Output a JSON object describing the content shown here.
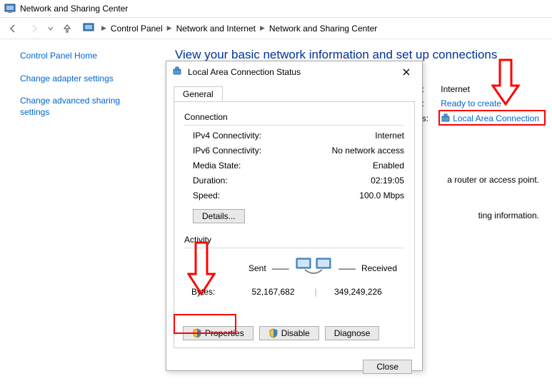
{
  "window": {
    "title": "Network and Sharing Center"
  },
  "breadcrumb": {
    "items": [
      "Control Panel",
      "Network and Internet",
      "Network and Sharing Center"
    ]
  },
  "sidebar": {
    "items": [
      {
        "label": "Control Panel Home"
      },
      {
        "label": "Change adapter settings"
      },
      {
        "label": "Change advanced sharing settings"
      }
    ]
  },
  "main": {
    "heading": "View your basic network information and set up connections",
    "access_type_label": "pe:",
    "access_type_value": "Internet",
    "homegroup_label": "up:",
    "homegroup_value": "Ready to create",
    "connections_label": "ons:",
    "connection_link": "Local Area Connection",
    "snippet_line1": "a router or access point.",
    "snippet_line2": "ting information."
  },
  "dialog": {
    "title": "Local Area Connection Status",
    "tab": "General",
    "connection_group": "Connection",
    "ipv4_label": "IPv4 Connectivity:",
    "ipv4_value": "Internet",
    "ipv6_label": "IPv6 Connectivity:",
    "ipv6_value": "No network access",
    "media_label": "Media State:",
    "media_value": "Enabled",
    "duration_label": "Duration:",
    "duration_value": "02:19:05",
    "speed_label": "Speed:",
    "speed_value": "100.0 Mbps",
    "details_btn": "Details...",
    "activity_group": "Activity",
    "sent_label": "Sent",
    "received_label": "Received",
    "bytes_label": "Bytes:",
    "sent_bytes": "52,167,682",
    "received_bytes": "349,249,226",
    "properties_btn": "Properties",
    "disable_btn": "Disable",
    "diagnose_btn": "Diagnose",
    "close_btn": "Close"
  }
}
